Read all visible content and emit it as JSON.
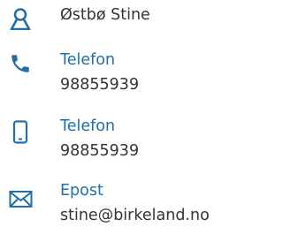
{
  "contact": {
    "name": "Østbø Stine",
    "phone": {
      "label": "Telefon",
      "value": "98855939",
      "icon": "phone-icon"
    },
    "mobile": {
      "label": "Telefon",
      "value": "98855939",
      "icon": "mobile-phone-icon"
    },
    "email": {
      "label": "Epost",
      "value": "stine@birkeland.no",
      "icon": "envelope-icon"
    },
    "person_icon": "person-icon",
    "accent_color": "#1f6fa8"
  }
}
